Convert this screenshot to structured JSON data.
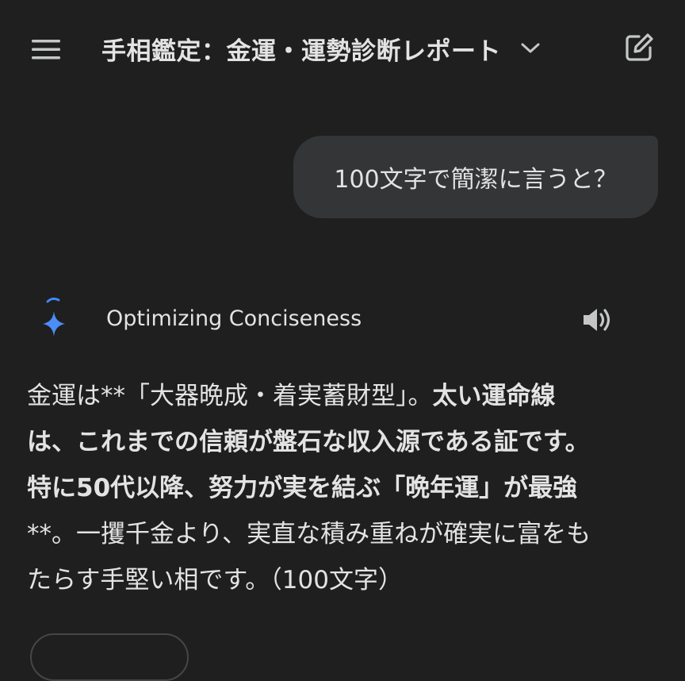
{
  "header": {
    "menu_icon": "hamburger-menu-icon",
    "title": "手相鑑定：金運・運勢診断レポート",
    "dropdown_icon": "chevron-down-icon",
    "edit_icon": "edit-new-chat-icon"
  },
  "user_message": {
    "text": "100文字で簡潔に言うと？"
  },
  "response": {
    "icon": "gemini-sparkle-icon",
    "status": "Optimizing Conciseness",
    "speaker_icon": "speaker-volume-icon",
    "lines": [
      {
        "normal": "金運は**「大器晩成・着実蓄財型」。",
        "bold": "太い運命線"
      },
      {
        "normal": "",
        "bold": "は、これまでの信頼が盤石な収入源である証です。"
      },
      {
        "normal": "",
        "bold": "特に50代以降、努力が実を結ぶ「晩年運」が最強"
      },
      {
        "normal": "**。一攫千金より、実直な積み重ねが確実に富をも",
        "bold": ""
      },
      {
        "normal": "たらす手堅い相です。（100文字）",
        "bold": ""
      }
    ]
  },
  "colors": {
    "background": "#1f1f1f",
    "bubble": "#333537",
    "text": "#e3e3e3",
    "accent_blue": "#4285f4"
  }
}
